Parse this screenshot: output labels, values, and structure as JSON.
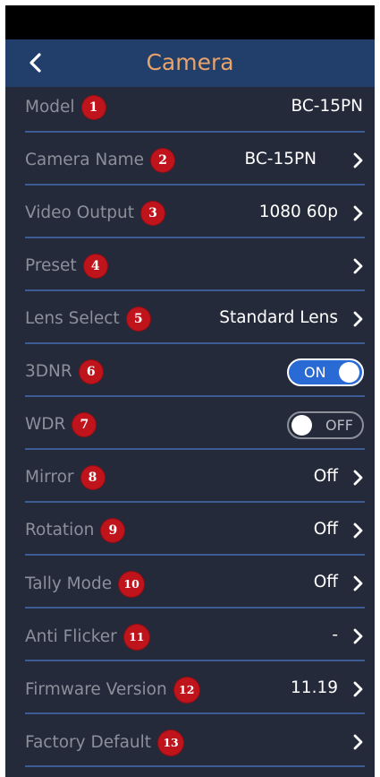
{
  "header": {
    "title": "Camera",
    "back_icon": "chevron-left-icon"
  },
  "colors": {
    "background": "#242a3a",
    "header": "#223e6b",
    "title": "#e8a46a",
    "label": "#8b909b",
    "value": "#ffffff",
    "divider": "#3b5c94",
    "badge": "#c0141c",
    "toggle_on": "#2a6ad4"
  },
  "rows": [
    {
      "label": "Model",
      "badge": "1",
      "value": "BC-15PN"
    },
    {
      "label": "Camera Name",
      "badge": "2",
      "value": "BC-15PN"
    },
    {
      "label": "Video Output",
      "badge": "3",
      "value": "1080 60p"
    },
    {
      "label": "Preset",
      "badge": "4",
      "value": ""
    },
    {
      "label": "Lens Select",
      "badge": "5",
      "value": "Standard Lens"
    },
    {
      "label": "3DNR",
      "badge": "6",
      "toggle": "ON"
    },
    {
      "label": "WDR",
      "badge": "7",
      "toggle": "OFF"
    },
    {
      "label": "Mirror",
      "badge": "8",
      "value": "Off"
    },
    {
      "label": "Rotation",
      "badge": "9",
      "value": "Off"
    },
    {
      "label": "Tally Mode",
      "badge": "10",
      "value": "Off"
    },
    {
      "label": "Anti Flicker",
      "badge": "11",
      "value": "-"
    },
    {
      "label": "Firmware Version",
      "badge": "12",
      "value": "11.19"
    },
    {
      "label": "Factory Default",
      "badge": "13",
      "value": ""
    }
  ]
}
